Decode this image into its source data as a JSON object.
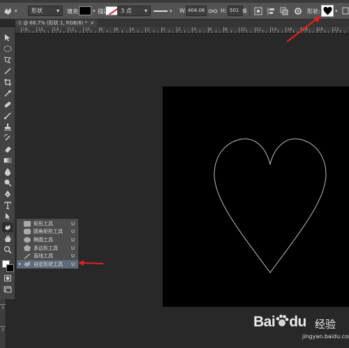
{
  "options_bar": {
    "mode": "形状",
    "fill_label": "填充:",
    "stroke_label": "描边:",
    "stroke_width": "3 点",
    "w_label": "W:",
    "w_value": "404.06",
    "h_label": "H:",
    "h_value": "501",
    "h_unit_tail": "像",
    "shape_label": "形状:"
  },
  "document_tab": {
    "title": "-1 @ 66.7% (形状 1, RGB/8) *",
    "close": "×"
  },
  "ruler": {
    "top_labels": [
      "18",
      "16",
      "14",
      "12",
      "10",
      "8",
      "6",
      "4",
      "2",
      "0",
      "2",
      "4",
      "6",
      "8",
      "10",
      "12",
      "14",
      "16",
      "18",
      "20",
      "22"
    ],
    "left_labels": [
      "8",
      "6",
      "4",
      "2",
      "0",
      "2",
      "4",
      "6",
      "8",
      "1",
      "1",
      "2",
      "3",
      "3"
    ]
  },
  "flyout": {
    "items": [
      {
        "label": "矩形工具",
        "key": "U",
        "icon": "rectangle-icon",
        "selected": false
      },
      {
        "label": "圆角矩形工具",
        "key": "U",
        "icon": "rounded-rectangle-icon",
        "selected": false
      },
      {
        "label": "椭圆工具",
        "key": "U",
        "icon": "ellipse-icon",
        "selected": false
      },
      {
        "label": "多边形工具",
        "key": "U",
        "icon": "polygon-icon",
        "selected": false
      },
      {
        "label": "直线工具",
        "key": "U",
        "icon": "line-icon",
        "selected": false
      },
      {
        "label": "自定形状工具",
        "key": "U",
        "icon": "custom-shape-icon",
        "selected": true,
        "bullet": "•"
      }
    ]
  },
  "colors": {
    "accent_arrow": "#e0211c",
    "canvas": "#000000",
    "panel": "#535353"
  },
  "watermark": {
    "logo_text": "Bai",
    "logo_text2": "du",
    "cn_text": "经验",
    "url": "jingyan.baidu.com"
  }
}
